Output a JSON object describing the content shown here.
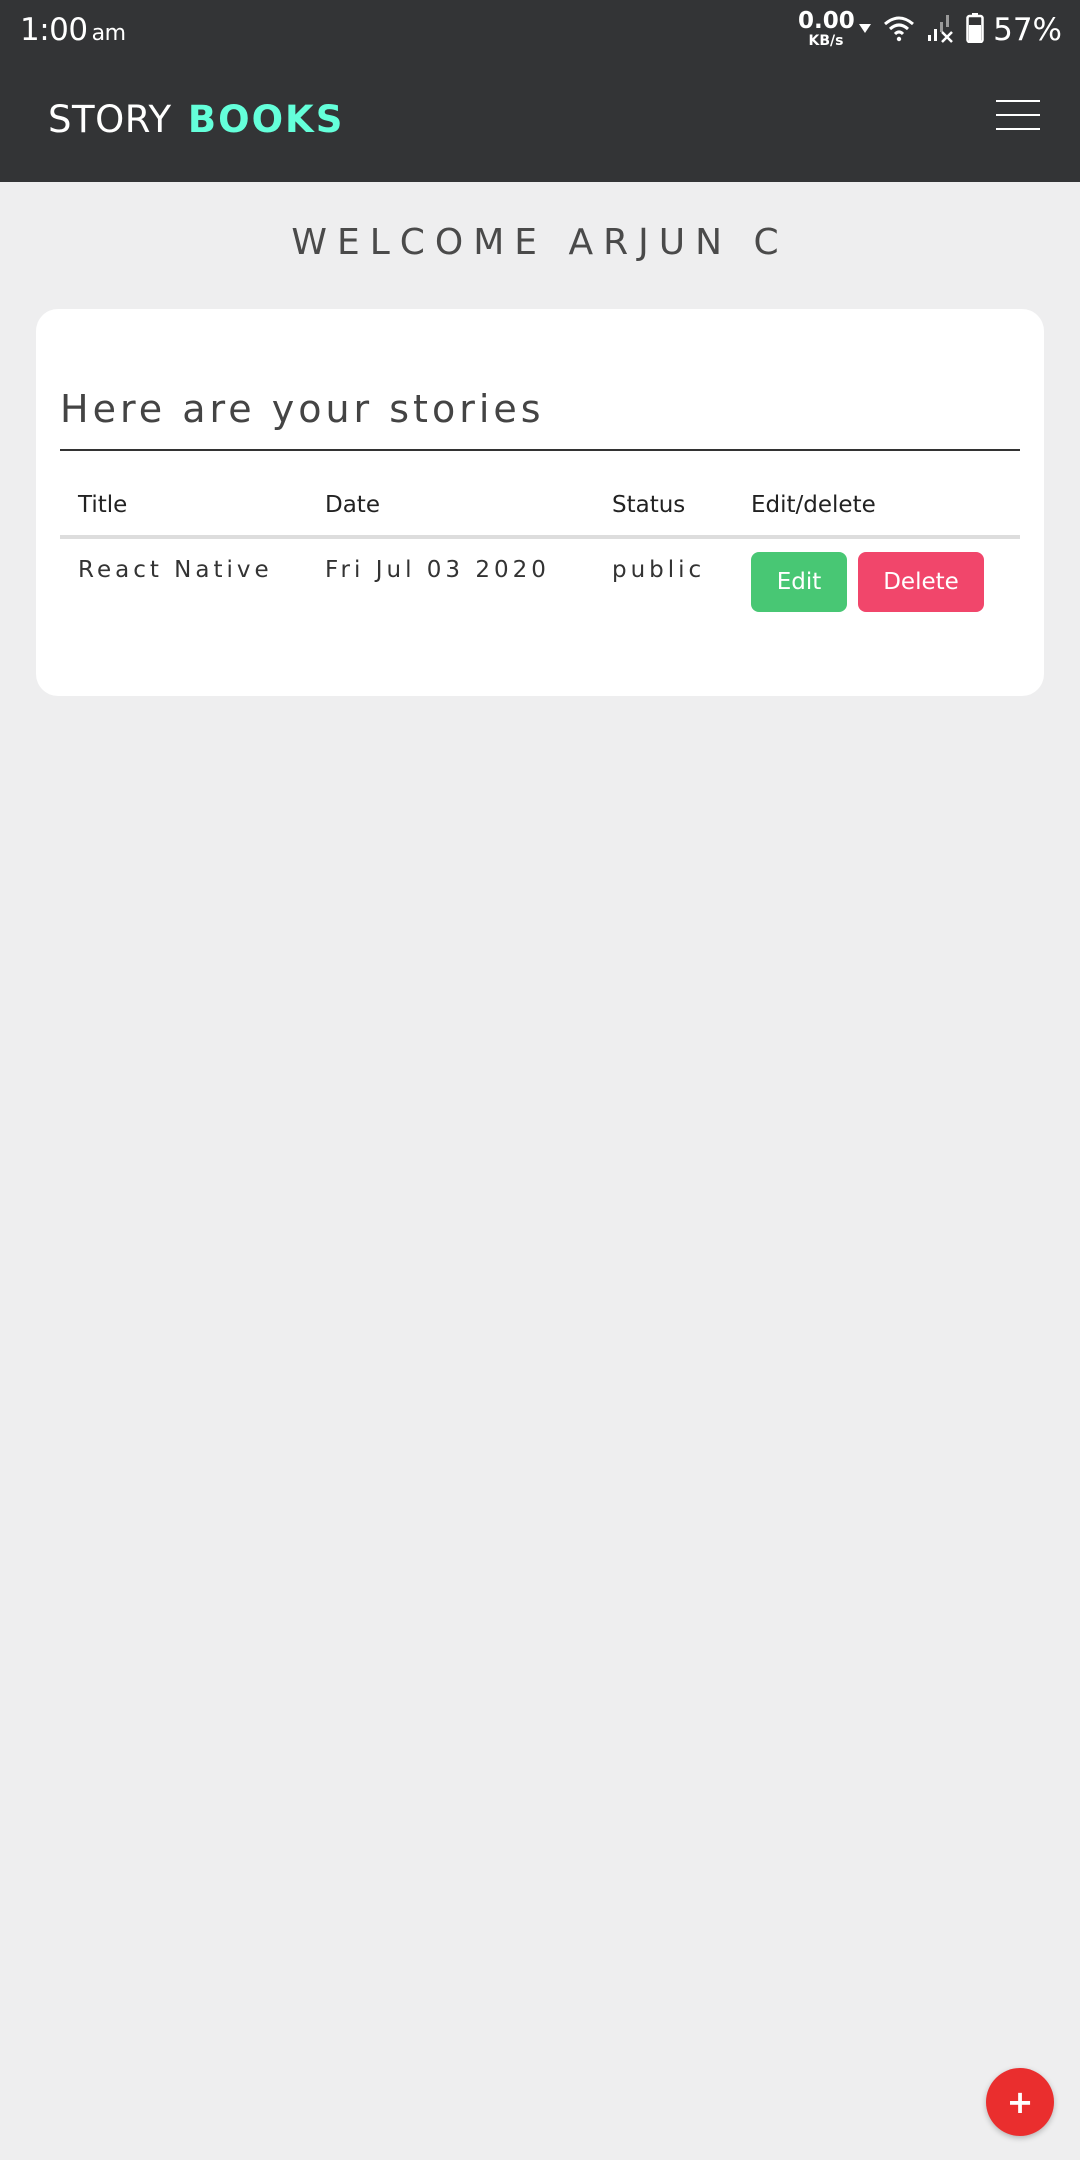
{
  "status_bar": {
    "time": "1:00",
    "ampm": "am",
    "speed_value": "0.00",
    "speed_unit": "KB/s",
    "battery_percent": "57%",
    "icons": [
      "download-arrow-icon",
      "wifi-icon",
      "signal-off-icon",
      "battery-icon"
    ]
  },
  "app_bar": {
    "brand_part1": "STORY",
    "brand_part2": "BOOKS",
    "menu_icon": "hamburger-menu-icon"
  },
  "welcome_text": "WELCOME ARJUN C",
  "stories_card": {
    "heading": "Here are your stories",
    "columns": [
      "Title",
      "Date",
      "Status",
      "Edit/delete"
    ],
    "rows": [
      {
        "title": "React Native",
        "date": "Fri Jul 03 2020",
        "status": "public",
        "edit_label": "Edit",
        "delete_label": "Delete"
      }
    ]
  },
  "fab": {
    "label": "+",
    "icon": "plus-icon"
  },
  "colors": {
    "appbar_bg": "#333436",
    "brand_accent": "#64ffda",
    "page_bg": "#eeeeef",
    "edit_button": "#48c774",
    "delete_button": "#f1466b",
    "fab": "#ea2e2e"
  }
}
